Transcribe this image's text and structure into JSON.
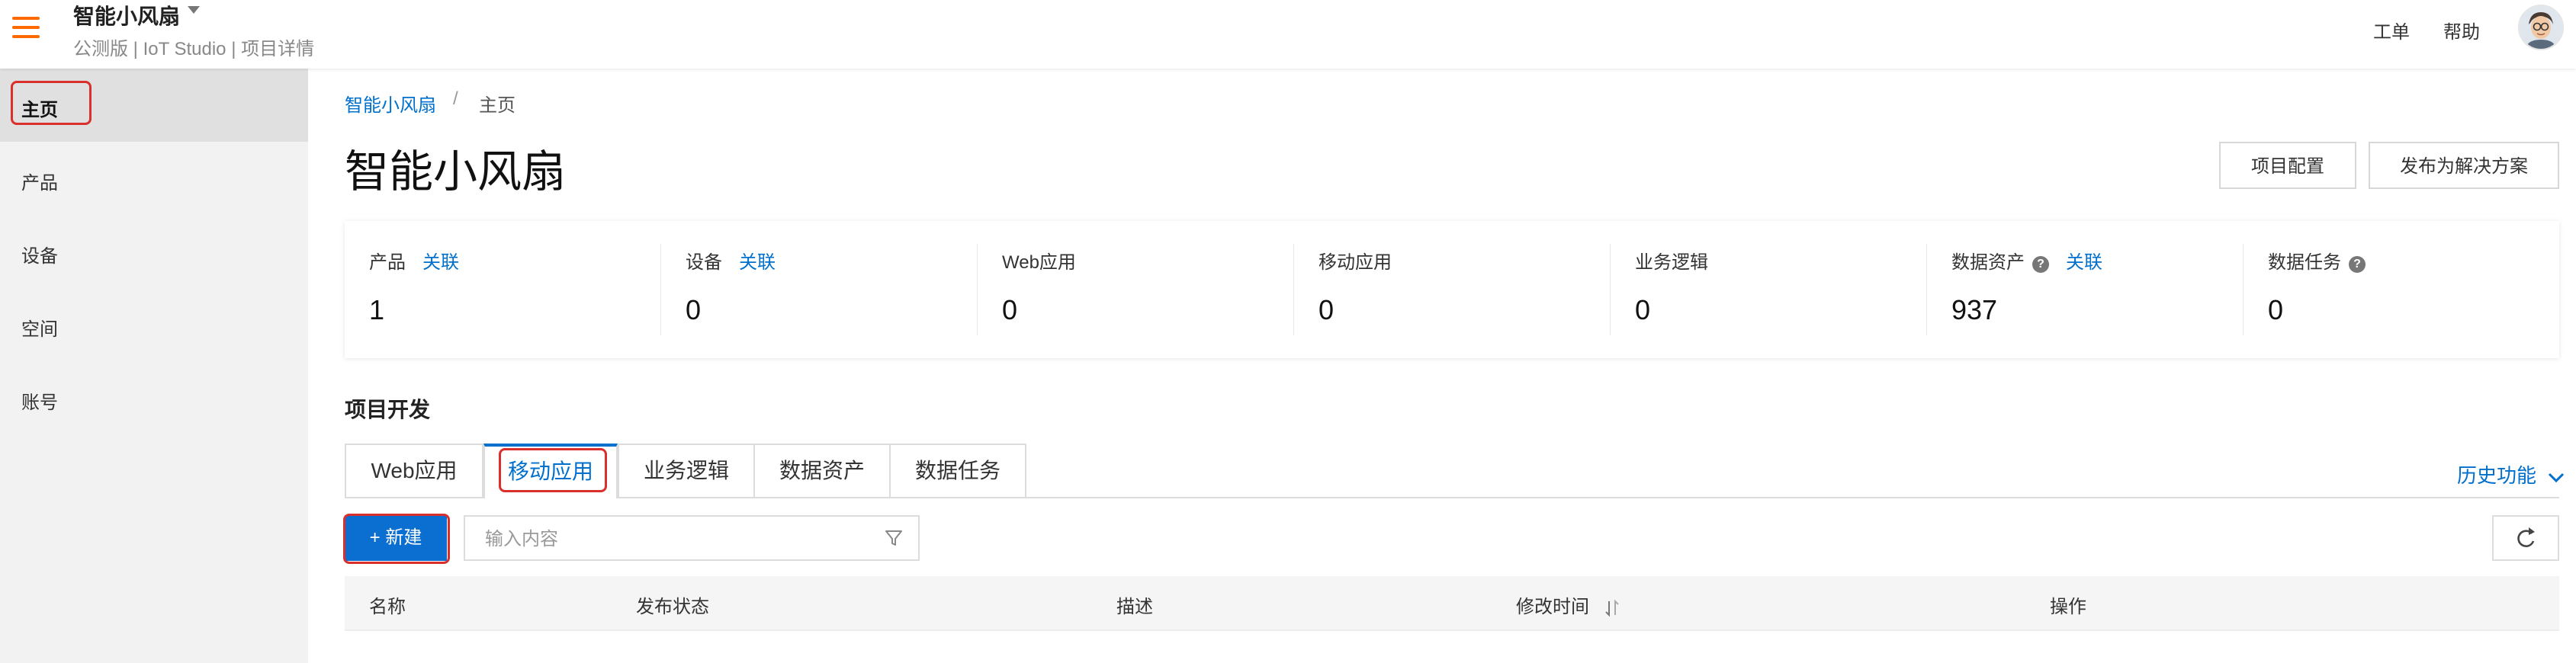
{
  "header": {
    "project_name": "智能小风扇",
    "subtitle": "公测版 | IoT Studio | 项目详情",
    "links": {
      "ticket": "工单",
      "help": "帮助"
    }
  },
  "sidebar": {
    "items": [
      {
        "label": "主页",
        "active": true
      },
      {
        "label": "产品"
      },
      {
        "label": "设备"
      },
      {
        "label": "空间"
      },
      {
        "label": "账号"
      }
    ]
  },
  "breadcrumb": {
    "parent": "智能小风扇",
    "separator": "/",
    "current": "主页"
  },
  "page": {
    "title": "智能小风扇",
    "actions": {
      "config": "项目配置",
      "publish": "发布为解决方案"
    }
  },
  "stats": [
    {
      "label": "产品",
      "link": "关联",
      "value": "1"
    },
    {
      "label": "设备",
      "link": "关联",
      "value": "0"
    },
    {
      "label": "Web应用",
      "value": "0"
    },
    {
      "label": "移动应用",
      "value": "0"
    },
    {
      "label": "业务逻辑",
      "value": "0"
    },
    {
      "label": "数据资产",
      "help": "?",
      "link": "关联",
      "value": "937"
    },
    {
      "label": "数据任务",
      "help": "?",
      "value": "0"
    }
  ],
  "dev": {
    "section_title": "项目开发",
    "tabs": [
      {
        "label": "Web应用"
      },
      {
        "label": "移动应用",
        "active": true
      },
      {
        "label": "业务逻辑"
      },
      {
        "label": "数据资产"
      },
      {
        "label": "数据任务"
      }
    ],
    "history_link": "历史功能",
    "new_button": "+ 新建",
    "search_placeholder": "输入内容",
    "table_headers": [
      "名称",
      "发布状态",
      "描述",
      "修改时间",
      "操作"
    ]
  },
  "colors": {
    "accent": "#0070cc",
    "brand_orange": "#ff6a00",
    "highlight": "#d9302d"
  },
  "icons": [
    "menu-icon",
    "caret-down-icon",
    "avatar",
    "help-icon",
    "chevron-down-icon",
    "filter-icon",
    "refresh-icon",
    "sort-icon"
  ]
}
